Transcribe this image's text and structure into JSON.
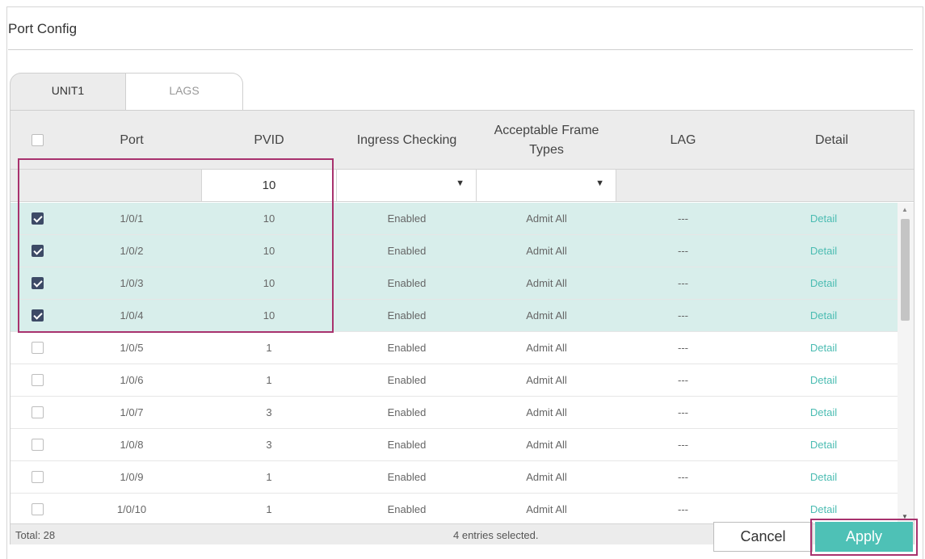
{
  "panel": {
    "title": "Port Config"
  },
  "tabs": [
    {
      "label": "UNIT1",
      "active": true
    },
    {
      "label": "LAGS",
      "active": false
    }
  ],
  "table": {
    "headers": {
      "port": "Port",
      "pvid": "PVID",
      "ingress": "Ingress Checking",
      "frame_line1": "Acceptable Frame",
      "frame_line2": "Types",
      "lag": "LAG",
      "detail": "Detail"
    },
    "edit_row": {
      "pvid_value": "10",
      "ingress_value": "",
      "frame_value": ""
    },
    "rows": [
      {
        "checked": true,
        "port": "1/0/1",
        "pvid": "10",
        "ingress": "Enabled",
        "frame": "Admit All",
        "lag": "---",
        "detail": "Detail"
      },
      {
        "checked": true,
        "port": "1/0/2",
        "pvid": "10",
        "ingress": "Enabled",
        "frame": "Admit All",
        "lag": "---",
        "detail": "Detail"
      },
      {
        "checked": true,
        "port": "1/0/3",
        "pvid": "10",
        "ingress": "Enabled",
        "frame": "Admit All",
        "lag": "---",
        "detail": "Detail"
      },
      {
        "checked": true,
        "port": "1/0/4",
        "pvid": "10",
        "ingress": "Enabled",
        "frame": "Admit All",
        "lag": "---",
        "detail": "Detail"
      },
      {
        "checked": false,
        "port": "1/0/5",
        "pvid": "1",
        "ingress": "Enabled",
        "frame": "Admit All",
        "lag": "---",
        "detail": "Detail"
      },
      {
        "checked": false,
        "port": "1/0/6",
        "pvid": "1",
        "ingress": "Enabled",
        "frame": "Admit All",
        "lag": "---",
        "detail": "Detail"
      },
      {
        "checked": false,
        "port": "1/0/7",
        "pvid": "3",
        "ingress": "Enabled",
        "frame": "Admit All",
        "lag": "---",
        "detail": "Detail"
      },
      {
        "checked": false,
        "port": "1/0/8",
        "pvid": "3",
        "ingress": "Enabled",
        "frame": "Admit All",
        "lag": "---",
        "detail": "Detail"
      },
      {
        "checked": false,
        "port": "1/0/9",
        "pvid": "1",
        "ingress": "Enabled",
        "frame": "Admit All",
        "lag": "---",
        "detail": "Detail"
      },
      {
        "checked": false,
        "port": "1/0/10",
        "pvid": "1",
        "ingress": "Enabled",
        "frame": "Admit All",
        "lag": "---",
        "detail": "Detail"
      }
    ]
  },
  "footer": {
    "total": "Total: 28",
    "selection": "4 entries selected."
  },
  "buttons": {
    "cancel": "Cancel",
    "apply": "Apply"
  },
  "colors": {
    "accent": "#4ec1b6",
    "selected_row": "#d8eeeb",
    "highlight": "#a8326e",
    "checkbox": "#3d4a66"
  }
}
